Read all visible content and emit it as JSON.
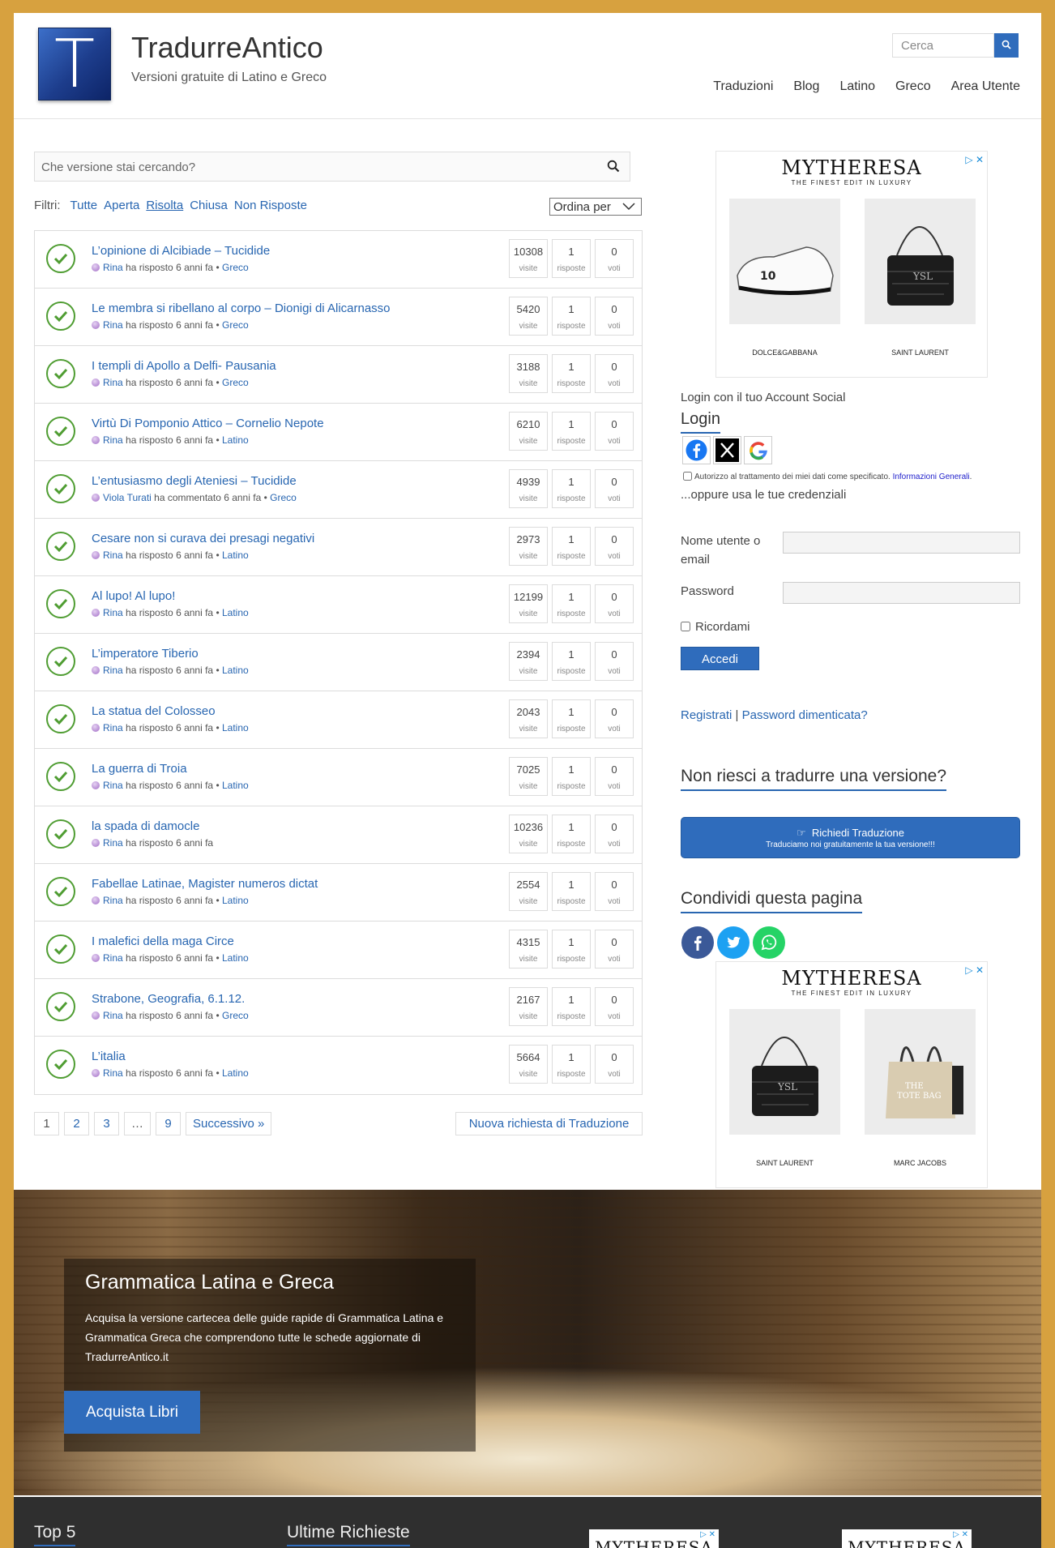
{
  "header": {
    "logo_letter": "T",
    "title": "TradurreAntico",
    "subtitle": "Versioni gratuite di Latino e Greco",
    "search_placeholder": "Cerca",
    "nav": [
      "Traduzioni",
      "Blog",
      "Latino",
      "Greco",
      "Area Utente"
    ]
  },
  "main": {
    "search_placeholder": "Che versione stai cercando?",
    "filters_label": "Filtri:",
    "filters": [
      "Tutte",
      "Aperta",
      "Risolta",
      "Chiusa",
      "Non Risposte"
    ],
    "filter_selected": "Risolta",
    "sort_label": "Ordina per",
    "stat_labels": {
      "views": "visite",
      "answers": "risposte",
      "votes": "voti"
    },
    "questions": [
      {
        "title": "L’opinione di Alcibiade – Tucidide",
        "user": "Rina",
        "action": "ha risposto 6 anni fa",
        "category": "Greco",
        "views": "10308",
        "answers": "1",
        "votes": "0"
      },
      {
        "title": "Le membra si ribellano al corpo – Dionigi di Alicarnasso",
        "user": "Rina",
        "action": "ha risposto 6 anni fa",
        "category": "Greco",
        "views": "5420",
        "answers": "1",
        "votes": "0"
      },
      {
        "title": "I templi di Apollo a Delfi- Pausania",
        "user": "Rina",
        "action": "ha risposto 6 anni fa",
        "category": "Greco",
        "views": "3188",
        "answers": "1",
        "votes": "0"
      },
      {
        "title": "Virtù Di Pomponio Attico – Cornelio Nepote",
        "user": "Rina",
        "action": "ha risposto 6 anni fa",
        "category": "Latino",
        "views": "6210",
        "answers": "1",
        "votes": "0"
      },
      {
        "title": "L’entusiasmo degli Ateniesi – Tucidide",
        "user": "Viola Turati",
        "action": "ha commentato 6 anni fa",
        "category": "Greco",
        "views": "4939",
        "answers": "1",
        "votes": "0"
      },
      {
        "title": "Cesare non si curava dei presagi negativi",
        "user": "Rina",
        "action": "ha risposto 6 anni fa",
        "category": "Latino",
        "views": "2973",
        "answers": "1",
        "votes": "0"
      },
      {
        "title": "Al lupo! Al lupo!",
        "user": "Rina",
        "action": "ha risposto 6 anni fa",
        "category": "Latino",
        "views": "12199",
        "answers": "1",
        "votes": "0"
      },
      {
        "title": "L’imperatore Tiberio",
        "user": "Rina",
        "action": "ha risposto 6 anni fa",
        "category": "Latino",
        "views": "2394",
        "answers": "1",
        "votes": "0"
      },
      {
        "title": "La statua del Colosseo",
        "user": "Rina",
        "action": "ha risposto 6 anni fa",
        "category": "Latino",
        "views": "2043",
        "answers": "1",
        "votes": "0"
      },
      {
        "title": "La guerra di Troia",
        "user": "Rina",
        "action": "ha risposto 6 anni fa",
        "category": "Latino",
        "views": "7025",
        "answers": "1",
        "votes": "0"
      },
      {
        "title": "la spada di damocle",
        "user": "Rina",
        "action": "ha risposto 6 anni fa",
        "category": "",
        "views": "10236",
        "answers": "1",
        "votes": "0"
      },
      {
        "title": "Fabellae Latinae, Magister numeros dictat",
        "user": "Rina",
        "action": "ha risposto 6 anni fa",
        "category": "Latino",
        "views": "2554",
        "answers": "1",
        "votes": "0"
      },
      {
        "title": "I malefici della maga Circe",
        "user": "Rina",
        "action": "ha risposto 6 anni fa",
        "category": "Latino",
        "views": "4315",
        "answers": "1",
        "votes": "0"
      },
      {
        "title": "Strabone, Geografia, 6.1.12.",
        "user": "Rina",
        "action": "ha risposto 6 anni fa",
        "category": "Greco",
        "views": "2167",
        "answers": "1",
        "votes": "0"
      },
      {
        "title": "L’italia",
        "user": "Rina",
        "action": "ha risposto 6 anni fa",
        "category": "Latino",
        "views": "5664",
        "answers": "1",
        "votes": "0"
      }
    ],
    "pagination": [
      "1",
      "2",
      "3",
      "…",
      "9",
      "Successivo »"
    ],
    "new_request": "Nuova richiesta di Traduzione"
  },
  "sidebar": {
    "ad1": {
      "brand": "MYTHERESA",
      "tagline": "THE FINEST EDIT IN LUXURY",
      "items": [
        "DOLCE&GABBANA",
        "SAINT LAURENT"
      ]
    },
    "social_login_label": "Login con il tuo Account Social",
    "login_heading": "Login",
    "privacy_text": "Autorizzo al trattamento dei miei dati come specificato.",
    "privacy_link": "Informazioni Generali",
    "or_credentials": "...oppure usa le tue credenziali",
    "username_label": "Nome utente o email",
    "password_label": "Password",
    "remember_label": "Ricordami",
    "login_button": "Accedi",
    "register_link": "Registrati",
    "separator": "|",
    "forgot_link": "Password dimenticata?",
    "help_heading": "Non riesci a tradurre una versione?",
    "request_button": "Richiedi Traduzione",
    "request_sub": "Traduciamo noi gratuitamente la tua versione!!!",
    "share_heading": "Condividi questa pagina",
    "ad2": {
      "brand": "MYTHERESA",
      "tagline": "THE FINEST EDIT IN LUXURY",
      "items": [
        "SAINT LAURENT",
        "MARC JACOBS"
      ]
    }
  },
  "banner": {
    "title": "Grammatica Latina e Greca",
    "text": "Acquisa la versione cartecea delle guide rapide di Grammatica Latina e Grammatica Greca che comprendono tutte le schede aggiornate di TradurreAntico.it",
    "button": "Acquista Libri"
  },
  "footer": {
    "col1": "Top 5",
    "col2": "Ultime Richieste",
    "ad_brand": "MYTHERESA"
  },
  "colors": {
    "accent": "#2f6cbc",
    "page_bg": "#d7a13f",
    "check": "#4f9d32",
    "link": "#2866b1"
  }
}
